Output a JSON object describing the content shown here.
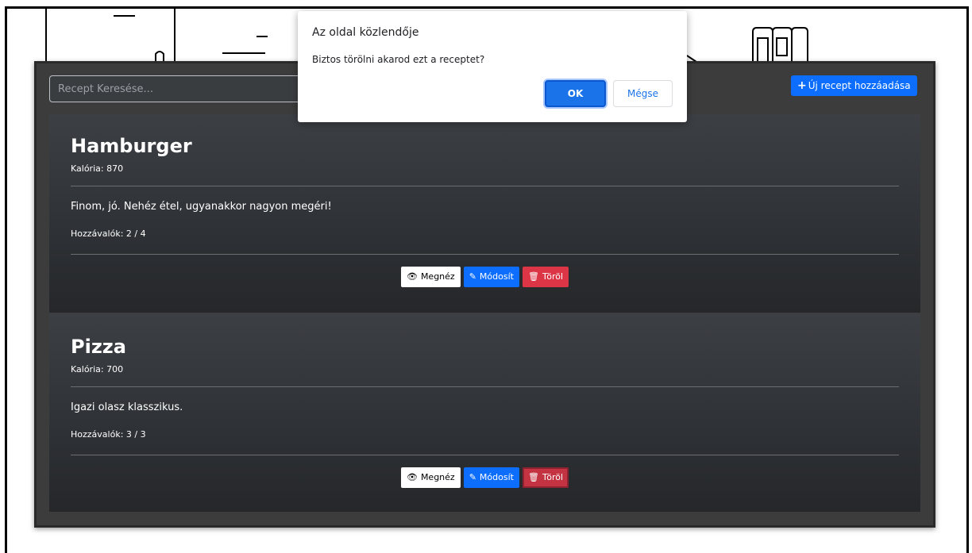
{
  "search": {
    "placeholder": "Recept Keresése..."
  },
  "header": {
    "add_button_label": "Új recept hozzáadása"
  },
  "recipes": [
    {
      "title": "Hamburger",
      "calories": "Kalória: 870",
      "description": "Finom, jó. Nehéz étel, ugyanakkor nagyon megéri!",
      "ingredients": "Hozzávalók: 2 / 4",
      "view_label": "Megnéz",
      "edit_label": "Módosít",
      "delete_label": "Töröl"
    },
    {
      "title": "Pizza",
      "calories": "Kalória: 700",
      "description": "Igazi olasz klasszikus.",
      "ingredients": "Hozzávalók: 3 / 3",
      "view_label": "Megnéz",
      "edit_label": "Módosít",
      "delete_label": "Töröl"
    }
  ],
  "dialog": {
    "title": "Az oldal közlendője",
    "message": "Biztos törölni akarod ezt a receptet?",
    "ok_label": "OK",
    "cancel_label": "Mégse"
  },
  "icons": {
    "view": "eye-icon",
    "edit": "edit-icon",
    "delete": "trash-icon",
    "add": "plus-icon"
  },
  "colors": {
    "primary": "#0d6efd",
    "danger": "#dc3545",
    "card_bg": "#2e3135",
    "dialog_button": "#1a73e8"
  }
}
